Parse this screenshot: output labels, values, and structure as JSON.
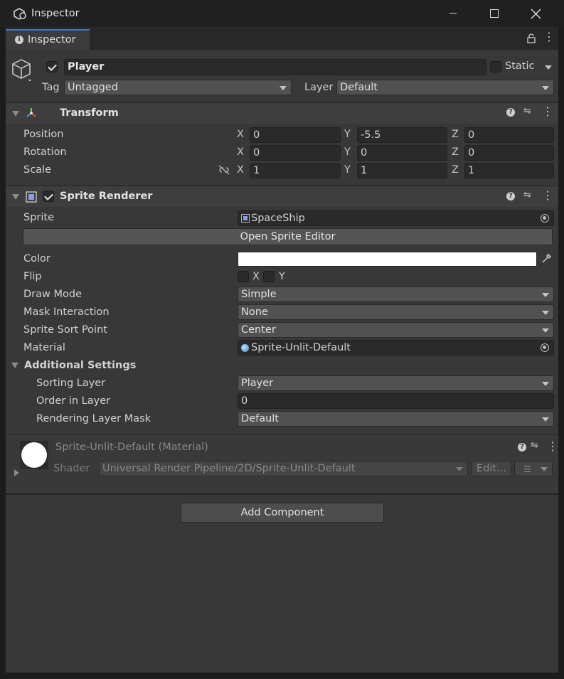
{
  "window": {
    "title": "Inspector",
    "tab_label": "Inspector",
    "min_icon": "minimize-icon",
    "max_icon": "maximize-icon",
    "close_icon": "close-icon"
  },
  "gameobject": {
    "name": "Player",
    "active": true,
    "static_label": "Static",
    "tag_label": "Tag",
    "tag_value": "Untagged",
    "layer_label": "Layer",
    "layer_value": "Default"
  },
  "transform": {
    "title": "Transform",
    "position_label": "Position",
    "rotation_label": "Rotation",
    "scale_label": "Scale",
    "x": "X",
    "y": "Y",
    "z": "Z",
    "position": {
      "x": "0",
      "y": "-5.5",
      "z": "0"
    },
    "rotation": {
      "x": "0",
      "y": "0",
      "z": "0"
    },
    "scale": {
      "x": "1",
      "y": "1",
      "z": "1"
    }
  },
  "sprite_renderer": {
    "title": "Sprite Renderer",
    "sprite_label": "Sprite",
    "sprite_value": "SpaceShip",
    "open_editor_label": "Open Sprite Editor",
    "color_label": "Color",
    "color_value": "#ffffff",
    "flip_label": "Flip",
    "flip_x": "X",
    "flip_y": "Y",
    "draw_mode_label": "Draw Mode",
    "draw_mode_value": "Simple",
    "mask_label": "Mask Interaction",
    "mask_value": "None",
    "sort_point_label": "Sprite Sort Point",
    "sort_point_value": "Center",
    "material_label": "Material",
    "material_value": "Sprite-Unlit-Default",
    "additional_label": "Additional Settings",
    "sorting_layer_label": "Sorting Layer",
    "sorting_layer_value": "Player",
    "order_label": "Order in Layer",
    "order_value": "0",
    "rendering_mask_label": "Rendering Layer Mask",
    "rendering_mask_value": "Default"
  },
  "material": {
    "title": "Sprite-Unlit-Default (Material)",
    "shader_label": "Shader",
    "shader_value": "Universal Render Pipeline/2D/Sprite-Unlit-Default",
    "edit_label": "Edit..."
  },
  "add_component_label": "Add Component"
}
